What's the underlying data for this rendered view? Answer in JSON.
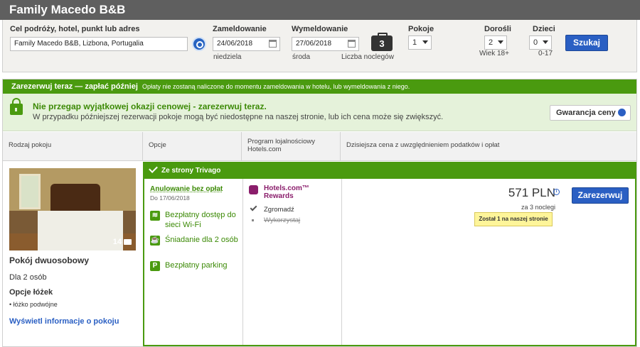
{
  "header": {
    "title": "Family Macedo B&B"
  },
  "search": {
    "destination_label": "Cel podróży, hotel, punkt lub adres",
    "destination_value": "Family Macedo B&B, Lizbona, Portugalia",
    "checkin_label": "Zameldowanie",
    "checkin_value": "24/06/2018",
    "checkin_day": "niedziela",
    "checkout_label": "Wymeldowanie",
    "checkout_value": "27/06/2018",
    "checkout_day": "środa",
    "nights_count": "3",
    "nights_label": "Liczba noclegów",
    "rooms_label": "Pokoje",
    "rooms_value": "1",
    "adults_label": "Dorośli",
    "adults_value": "2",
    "adults_hint": "Wiek 18+",
    "children_label": "Dzieci",
    "children_value": "0",
    "children_hint": "0-17",
    "search_button": "Szukaj"
  },
  "banner": {
    "title": "Zarezerwuj teraz — zapłać później",
    "text": "Opłaty nie zostaną naliczone do momentu zameldowania w hotelu, lub wymeldowania z niego."
  },
  "promo": {
    "title": "Nie przegap wyjątkowej okazji cenowej - zarezerwuj teraz.",
    "text": "W przypadku późniejszej rezerwacji pokoje mogą być niedostępne na naszej stronie, lub ich cena może się zwiększyć.",
    "guarantee_button": "Gwarancja ceny"
  },
  "table_headers": {
    "room_type": "Rodzaj pokoju",
    "options": "Opcje",
    "loyalty": "Program lojalnościowy Hotels.com",
    "price": "Dzisiejsza cena z uwzględnieniem podatków i opłat"
  },
  "room": {
    "photo_count": "14",
    "name": "Pokój dwuosobowy",
    "capacity": "Dla 2 osób",
    "bed_heading": "Opcje łóżek",
    "bed_option": "łóżko podwójne",
    "info_link": "Wyświetl informacje o pokoju"
  },
  "offer": {
    "source": "Ze strony Trivago",
    "cancellation": "Anulowanie bez opłat",
    "cancellation_date": "Do 17/06/2018",
    "amenities": [
      {
        "icon": "wifi-icon",
        "glyph": "≋",
        "label": "Bezpłatny dostęp do sieci Wi-Fi"
      },
      {
        "icon": "breakfast-icon",
        "glyph": "☕",
        "label": "Śniadanie dla 2 osób"
      },
      {
        "icon": "parking-icon",
        "glyph": "P",
        "label": "Bezpłatny parking"
      }
    ],
    "loyalty_name": "Hotels.com™ Rewards",
    "loyalty_collect": "Zgromadź",
    "loyalty_redeem": "Wykorzystaj",
    "price": "571 PLN",
    "price_note": "za 3 noclegi",
    "availability_badge": "Został 1 na naszej stronie",
    "book_button": "Zarezerwuj"
  },
  "colors": {
    "accent_green": "#4a9a0f",
    "button_blue": "#2a5fc3",
    "header_gray": "#5f5f5f"
  }
}
